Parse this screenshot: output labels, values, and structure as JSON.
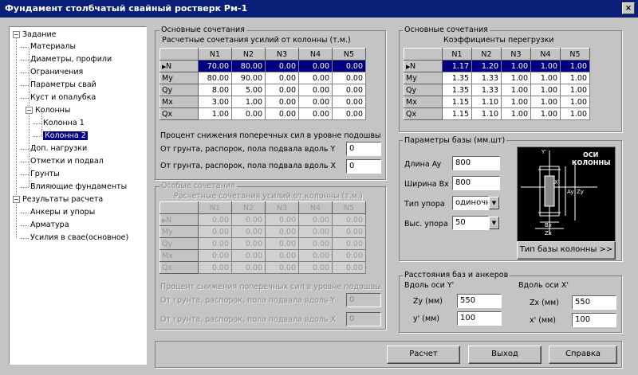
{
  "window": {
    "title": "Фундамент столбчатый свайный ростверк Рм-1",
    "close": "×"
  },
  "tree": {
    "items": [
      {
        "label": "Задание",
        "toggle": "−"
      },
      {
        "label": "Материалы"
      },
      {
        "label": "Диаметры, профили"
      },
      {
        "label": "Ограничения"
      },
      {
        "label": "Параметры свай"
      },
      {
        "label": "Куст и опалубка"
      },
      {
        "label": "Колонны",
        "toggle": "−"
      },
      {
        "label": "Колонна 1"
      },
      {
        "label": "Колонна 2"
      },
      {
        "label": "Доп. нагрузки"
      },
      {
        "label": "Отметки и подвал"
      },
      {
        "label": "Грунты"
      },
      {
        "label": "Влияющие фундаменты"
      },
      {
        "label": "Результаты расчета",
        "toggle": "−"
      },
      {
        "label": "Анкеры и упоры"
      },
      {
        "label": "Арматура"
      },
      {
        "label": "Усилия в свае(основное)"
      }
    ]
  },
  "basic": {
    "group_title": "Основные сочетания",
    "caption": "Расчетные сочетания усилий от колонны (т.м.)",
    "columns": [
      "N1",
      "N2",
      "N3",
      "N4",
      "N5"
    ],
    "rows": [
      {
        "label": "N",
        "values": [
          "70.00",
          "80.00",
          "0.00",
          "0.00",
          "0.00"
        ]
      },
      {
        "label": "My",
        "values": [
          "80.00",
          "90.00",
          "0.00",
          "0.00",
          "0.00"
        ]
      },
      {
        "label": "Qy",
        "values": [
          "8.00",
          "5.00",
          "0.00",
          "0.00",
          "0.00"
        ]
      },
      {
        "label": "Mx",
        "values": [
          "3.00",
          "1.00",
          "0.00",
          "0.00",
          "0.00"
        ]
      },
      {
        "label": "Qx",
        "values": [
          "1.00",
          "0.00",
          "0.00",
          "0.00",
          "0.00"
        ]
      }
    ],
    "percent_title": "Процент снижения поперечных сил в уровне подошвы",
    "percent_y_label": "От грунта, распорок, пола подвала вдоль Y",
    "percent_y_value": "0",
    "percent_x_label": "От грунта, распорок, пола подвала вдоль X",
    "percent_x_value": "0"
  },
  "special": {
    "group_title": "Особые сочетания",
    "caption": "Расчетные сочетания усилий от колонны (т.м.)",
    "columns": [
      "N1",
      "N2",
      "N3",
      "N4",
      "N5"
    ],
    "rows": [
      {
        "label": "N",
        "values": [
          "0.00",
          "0.00",
          "0.00",
          "0.00",
          "0.00"
        ]
      },
      {
        "label": "My",
        "values": [
          "0.00",
          "0.00",
          "0.00",
          "0.00",
          "0.00"
        ]
      },
      {
        "label": "Qy",
        "values": [
          "0.00",
          "0.00",
          "0.00",
          "0.00",
          "0.00"
        ]
      },
      {
        "label": "Mx",
        "values": [
          "0.00",
          "0.00",
          "0.00",
          "0.00",
          "0.00"
        ]
      },
      {
        "label": "Qx",
        "values": [
          "0.00",
          "0.00",
          "0.00",
          "0.00",
          "0.00"
        ]
      }
    ],
    "percent_title": "Процент снижения поперечных сил в уровне подошвы",
    "percent_y_label": "От грунта, распорок, пола подвала вдоль Y",
    "percent_y_value": "0",
    "percent_x_label": "От грунта, распорок, пола подвала вдоль X",
    "percent_x_value": "0"
  },
  "overload": {
    "group_title": "Основные сочетания",
    "caption": "Коэффициенты перегрузки",
    "columns": [
      "N1",
      "N2",
      "N3",
      "N4",
      "N5"
    ],
    "rows": [
      {
        "label": "N",
        "values": [
          "1.17",
          "1.20",
          "1.00",
          "1.00",
          "1.00"
        ]
      },
      {
        "label": "My",
        "values": [
          "1.35",
          "1.33",
          "1.00",
          "1.00",
          "1.00"
        ]
      },
      {
        "label": "Qy",
        "values": [
          "1.35",
          "1.33",
          "1.00",
          "1.00",
          "1.00"
        ]
      },
      {
        "label": "Mx",
        "values": [
          "1.15",
          "1.10",
          "1.00",
          "1.00",
          "1.00"
        ]
      },
      {
        "label": "Qx",
        "values": [
          "1.15",
          "1.10",
          "1.00",
          "1.00",
          "1.00"
        ]
      }
    ]
  },
  "base": {
    "group_title": "Параметры базы (мм.шт)",
    "length_label": "Длина Ay",
    "length_value": "800",
    "width_label": "Ширина Bx",
    "width_value": "800",
    "stop_type_label": "Тип упора",
    "stop_type_value": "одиночн",
    "stop_height_label": "Выс. упора",
    "stop_height_value": "50",
    "image_title_1": "ОСИ",
    "image_title_2": "КОЛОННЫ",
    "type_button": "Тип базы колонны >>"
  },
  "distances": {
    "group_title": "Расстояния баз и анкеров",
    "along_y": "Вдоль оси Y'",
    "zy_label": "Zy (мм)",
    "zy_value": "550",
    "yp_label": "y' (мм)",
    "yp_value": "100",
    "along_x": "Вдоль оси X'",
    "zx_label": "Zx (мм)",
    "zx_value": "550",
    "xp_label": "x' (мм)",
    "xp_value": "100"
  },
  "buttons": {
    "calc": "Расчет",
    "exit": "Выход",
    "help": "Справка"
  }
}
